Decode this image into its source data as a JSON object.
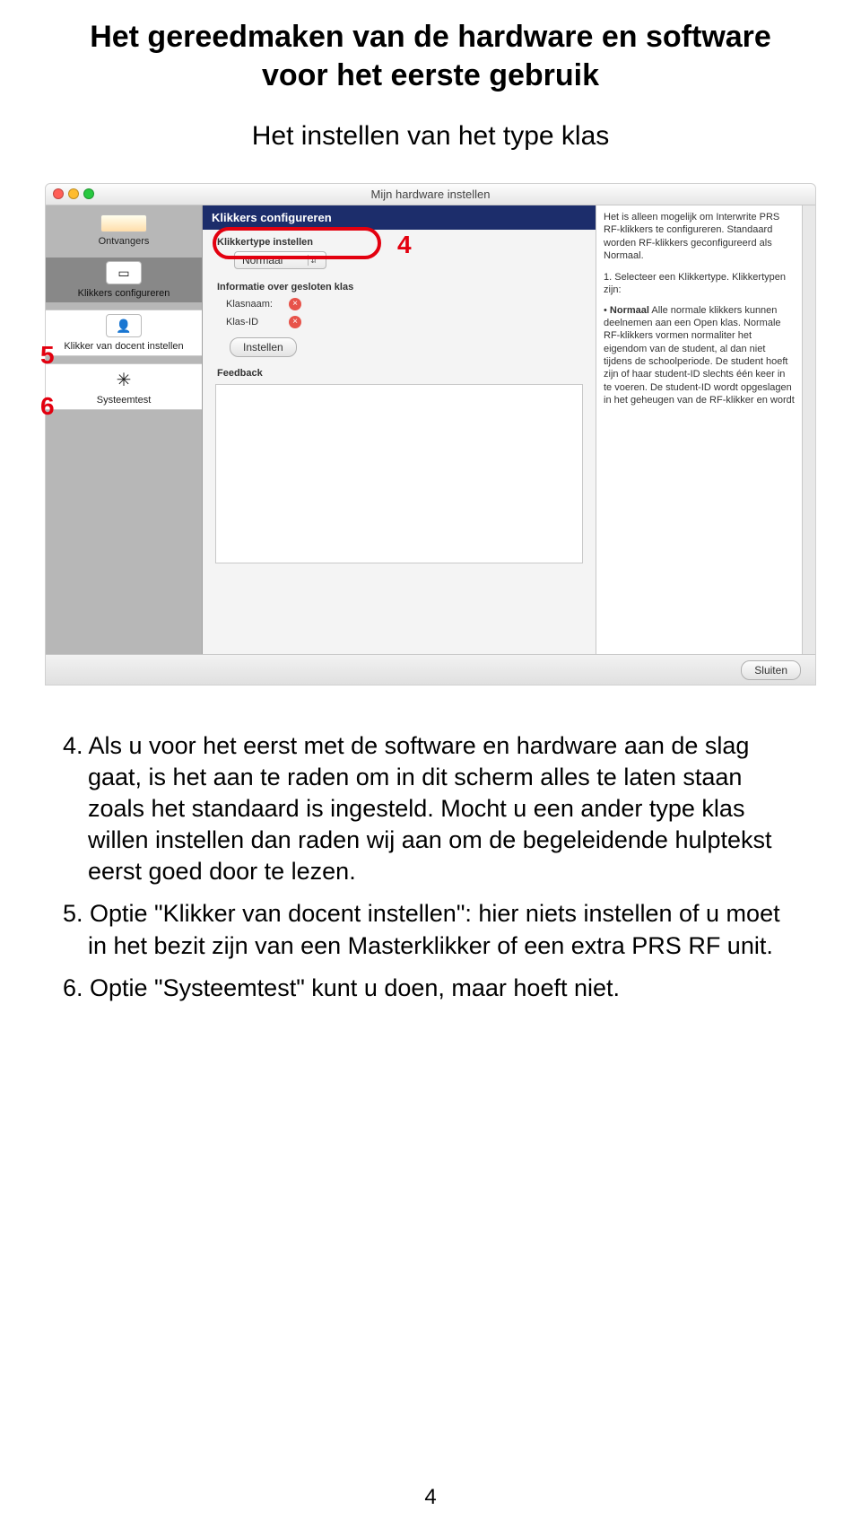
{
  "doc": {
    "title_line1": "Het gereedmaken van de hardware en software",
    "title_line2": "voor het eerste gebruik",
    "subtitle": "Het instellen van het type klas",
    "page_number": "4"
  },
  "shot": {
    "window_title": "Mijn hardware instellen",
    "header_bar": "Klikkers configureren",
    "sidebar": {
      "items": [
        {
          "label": "Ontvangers"
        },
        {
          "label": "Klikkers configureren"
        },
        {
          "label": "Klikker van docent instellen"
        },
        {
          "label": "Systeemtest"
        }
      ]
    },
    "center": {
      "sec1": "Klikkertype instellen",
      "dropdown_value": "Normaal",
      "sec2": "Informatie over gesloten klas",
      "klasnaam_label": "Klasnaam:",
      "klasid_label": "Klas-ID",
      "instellen_btn": "Instellen",
      "feedback_label": "Feedback"
    },
    "help": {
      "p1": "Het is alleen mogelijk om Interwrite PRS RF-klikkers te configureren. Standaard worden RF-klikkers geconfigureerd als Normaal.",
      "step1": "1. Selecteer een Klikkertype. Klikkertypen zijn:",
      "bullet_title": "Normaal",
      "bullet_body": "Alle normale klikkers kunnen deelnemen aan een Open klas. Normale RF-klikkers vormen normaliter het eigendom van de student, al dan niet tijdens de schoolperiode. De student hoeft zijn of haar student-ID slechts één keer in te voeren. De student-ID wordt opgeslagen in het geheugen van de RF-klikker en wordt"
    },
    "footer_btn": "Sluiten"
  },
  "annotations": {
    "n4": "4",
    "n5": "5",
    "n6": "6"
  },
  "list": {
    "i4": "4. Als u voor het eerst met de software en hardware aan de slag gaat, is het aan te raden om in dit scherm alles te laten staan zoals het standaard is ingesteld. Mocht u een ander type klas willen instellen dan raden wij aan om de begeleidende hulptekst eerst goed door te lezen.",
    "i5": "5. Optie \"Klikker van docent instellen\": hier niets instellen of u moet in het bezit zijn van een Masterklikker of een extra PRS RF unit.",
    "i6": "6. Optie \"Systeemtest\" kunt u doen, maar hoeft niet."
  }
}
